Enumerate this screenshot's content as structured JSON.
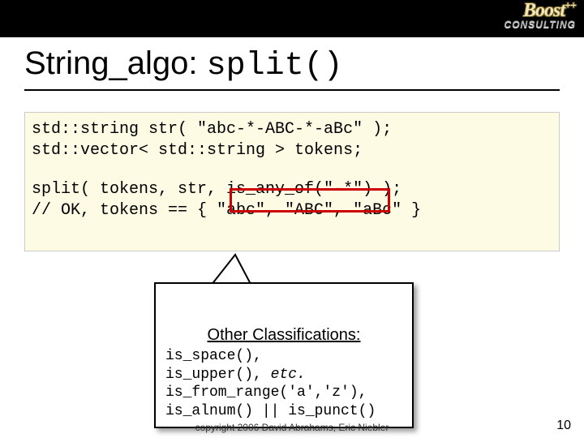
{
  "logo": {
    "main": "Boost",
    "sup": "++",
    "sub": "CONSULTING"
  },
  "title": {
    "pre": "String_algo: ",
    "mono": "split()"
  },
  "code": {
    "l1": "std::string str( \"abc-*-ABC-*-aBc\" );",
    "l2": "std::vector< std::string > tokens;",
    "l3": "split( tokens, str, is_any_of(\"-*\") );",
    "l4": "// OK, tokens == { \"abc\", \"ABC\", \"aBc\" }"
  },
  "callout": {
    "title": "Other Classifications:",
    "l1": "is_space(),",
    "l2a": "is_upper(), ",
    "l2b": "etc.",
    "l3": "is_from_range('a','z'),",
    "l4": "is_alnum() || is_punct()"
  },
  "footer": "copyright 2006 David Abrahams, Eric Niebler",
  "page": "10"
}
